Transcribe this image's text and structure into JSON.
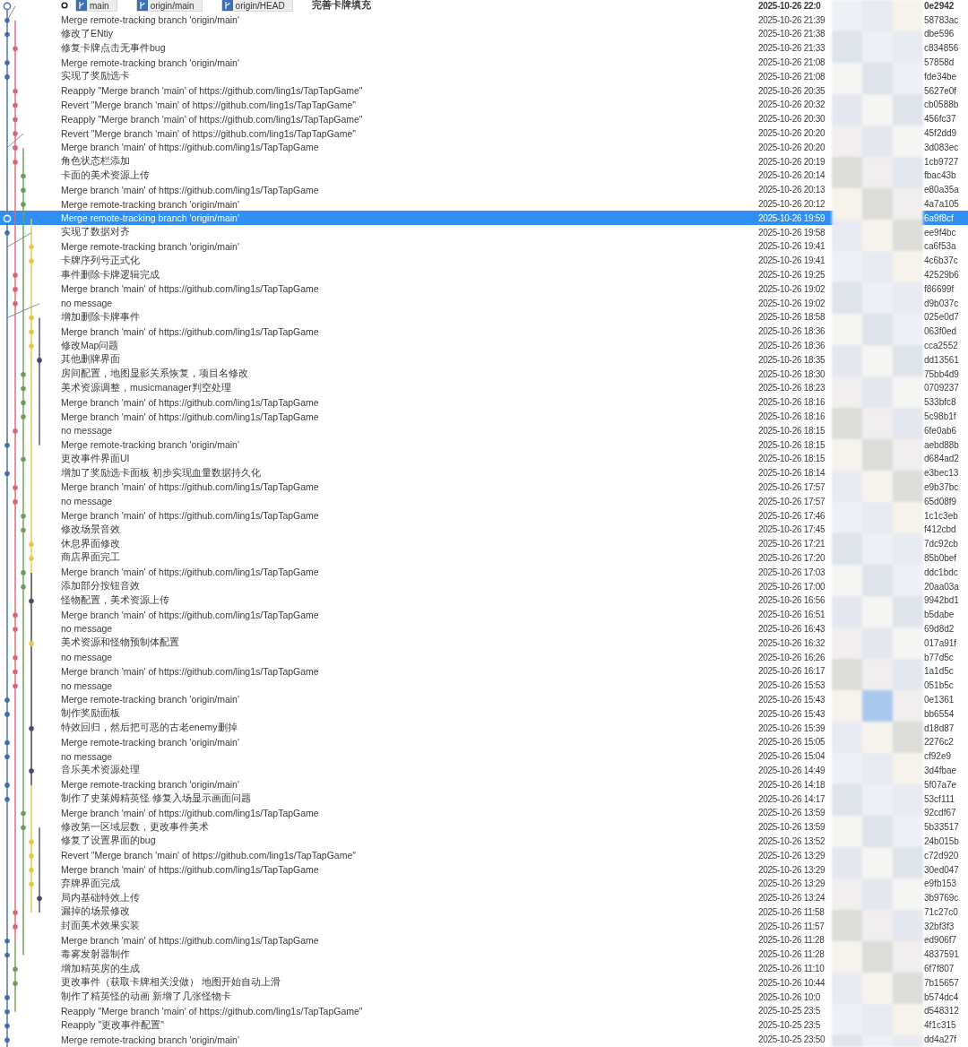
{
  "head": {
    "refs": [
      "main",
      "origin/main",
      "origin/HEAD"
    ],
    "message": "完善卡牌填充",
    "date": "2025-10-26 22:0",
    "hash": "0e2942"
  },
  "commits": [
    {
      "message": "Merge remote-tracking branch 'origin/main'",
      "date": "2025-10-26 21:39",
      "hash": "58783ac",
      "selected": false
    },
    {
      "message": "修改了ENtiy",
      "date": "2025-10-26 21:38",
      "hash": "dbe596",
      "selected": false
    },
    {
      "message": "修复卡牌点击无事件bug",
      "date": "2025-10-26 21:33",
      "hash": "c834856",
      "selected": false
    },
    {
      "message": "Merge remote-tracking branch 'origin/main'",
      "date": "2025-10-26 21:08",
      "hash": "57858d",
      "selected": false
    },
    {
      "message": "实现了奖励选卡",
      "date": "2025-10-26 21:08",
      "hash": "fde34be",
      "selected": false
    },
    {
      "message": "Reapply \"Merge branch 'main' of https://github.com/ling1s/TapTapGame\"",
      "date": "2025-10-26 20:35",
      "hash": "5627e0f",
      "selected": false
    },
    {
      "message": "Revert \"Merge branch 'main' of https://github.com/ling1s/TapTapGame\"",
      "date": "2025-10-26 20:32",
      "hash": "cb0588b",
      "selected": false
    },
    {
      "message": "Reapply \"Merge branch 'main' of https://github.com/ling1s/TapTapGame\"",
      "date": "2025-10-26 20:30",
      "hash": "456fc37",
      "selected": false
    },
    {
      "message": "Revert \"Merge branch 'main' of https://github.com/ling1s/TapTapGame\"",
      "date": "2025-10-26 20:20",
      "hash": "45f2dd9",
      "selected": false
    },
    {
      "message": "Merge branch 'main' of https://github.com/ling1s/TapTapGame",
      "date": "2025-10-26 20:20",
      "hash": "3d083ec",
      "selected": false
    },
    {
      "message": "角色状态栏添加",
      "date": "2025-10-26 20:19",
      "hash": "1cb9727",
      "selected": false
    },
    {
      "message": "卡面的美术资源上传",
      "date": "2025-10-26 20:14",
      "hash": "fbac43b",
      "selected": false
    },
    {
      "message": "Merge branch 'main' of https://github.com/ling1s/TapTapGame",
      "date": "2025-10-26 20:13",
      "hash": "e80a35a",
      "selected": false
    },
    {
      "message": "Merge remote-tracking branch 'origin/main'",
      "date": "2025-10-26 20:12",
      "hash": "4a7a105",
      "selected": false
    },
    {
      "message": "Merge remote-tracking branch 'origin/main'",
      "date": "2025-10-26 19:59",
      "hash": "6a9f8cf",
      "selected": true
    },
    {
      "message": "实现了数据对齐",
      "date": "2025-10-26 19:58",
      "hash": "ee9f4bc",
      "selected": false
    },
    {
      "message": "Merge remote-tracking branch 'origin/main'",
      "date": "2025-10-26 19:41",
      "hash": "ca6f53a",
      "selected": false
    },
    {
      "message": "卡牌序列号正式化",
      "date": "2025-10-26 19:41",
      "hash": "4c6b37c",
      "selected": false
    },
    {
      "message": "事件删除卡牌逻辑完成",
      "date": "2025-10-26 19:25",
      "hash": "42529b6",
      "selected": false
    },
    {
      "message": "Merge branch 'main' of https://github.com/ling1s/TapTapGame",
      "date": "2025-10-26 19:02",
      "hash": "f86699f",
      "selected": false
    },
    {
      "message": "no message",
      "date": "2025-10-26 19:02",
      "hash": "d9b037c",
      "selected": false
    },
    {
      "message": "增加删除卡牌事件",
      "date": "2025-10-26 18:58",
      "hash": "025e0d7",
      "selected": false
    },
    {
      "message": "Merge branch 'main' of https://github.com/ling1s/TapTapGame",
      "date": "2025-10-26 18:36",
      "hash": "063f0ed",
      "selected": false
    },
    {
      "message": "修改Map问题",
      "date": "2025-10-26 18:36",
      "hash": "cca2552",
      "selected": false
    },
    {
      "message": "其他删牌界面",
      "date": "2025-10-26 18:35",
      "hash": "dd13561",
      "selected": false
    },
    {
      "message": "房间配置，地图显影关系恢复，项目名修改",
      "date": "2025-10-26 18:30",
      "hash": "75bb4d9",
      "selected": false
    },
    {
      "message": "美术资源调整，musicmanager判空处理",
      "date": "2025-10-26 18:23",
      "hash": "0709237",
      "selected": false
    },
    {
      "message": "Merge branch 'main' of https://github.com/ling1s/TapTapGame",
      "date": "2025-10-26 18:16",
      "hash": "533bfc8",
      "selected": false
    },
    {
      "message": "Merge branch 'main' of https://github.com/ling1s/TapTapGame",
      "date": "2025-10-26 18:16",
      "hash": "5c98b1f",
      "selected": false
    },
    {
      "message": "no message",
      "date": "2025-10-26 18:15",
      "hash": "6fe0ab6",
      "selected": false
    },
    {
      "message": "Merge remote-tracking branch 'origin/main'",
      "date": "2025-10-26 18:15",
      "hash": "aebd88b",
      "selected": false
    },
    {
      "message": "更改事件界面UI",
      "date": "2025-10-26 18:15",
      "hash": "d684ad2",
      "selected": false
    },
    {
      "message": "增加了奖励选卡面板 初步实现血量数据持久化",
      "date": "2025-10-26 18:14",
      "hash": "e3bec13",
      "selected": false
    },
    {
      "message": "Merge branch 'main' of https://github.com/ling1s/TapTapGame",
      "date": "2025-10-26 17:57",
      "hash": "e9b37bc",
      "selected": false
    },
    {
      "message": "no message",
      "date": "2025-10-26 17:57",
      "hash": "65d08f9",
      "selected": false
    },
    {
      "message": "Merge branch 'main' of https://github.com/ling1s/TapTapGame",
      "date": "2025-10-26 17:46",
      "hash": "1c1c3eb",
      "selected": false
    },
    {
      "message": "修改场景音效",
      "date": "2025-10-26 17:45",
      "hash": "f412cbd",
      "selected": false
    },
    {
      "message": "休息界面修改",
      "date": "2025-10-26 17:21",
      "hash": "7dc92cb",
      "selected": false
    },
    {
      "message": "商店界面完工",
      "date": "2025-10-26 17:20",
      "hash": "85b0bef",
      "selected": false
    },
    {
      "message": "Merge branch 'main' of https://github.com/ling1s/TapTapGame",
      "date": "2025-10-26 17:03",
      "hash": "ddc1bdc",
      "selected": false
    },
    {
      "message": "添加部分按钮音效",
      "date": "2025-10-26 17:00",
      "hash": "20aa03a",
      "selected": false
    },
    {
      "message": "怪物配置，美术资源上传",
      "date": "2025-10-26 16:56",
      "hash": "9942bd1",
      "selected": false
    },
    {
      "message": "Merge branch 'main' of https://github.com/ling1s/TapTapGame",
      "date": "2025-10-26 16:51",
      "hash": "b5dabe",
      "selected": false
    },
    {
      "message": "no message",
      "date": "2025-10-26 16:43",
      "hash": "69d8d2",
      "selected": false
    },
    {
      "message": "美术资源和怪物预制体配置",
      "date": "2025-10-26 16:32",
      "hash": "017a91f",
      "selected": false
    },
    {
      "message": "no message",
      "date": "2025-10-26 16:26",
      "hash": "b77d5c",
      "selected": false
    },
    {
      "message": "Merge branch 'main' of https://github.com/ling1s/TapTapGame",
      "date": "2025-10-26 16:17",
      "hash": "1a1d5c",
      "selected": false
    },
    {
      "message": "no message",
      "date": "2025-10-26 15:53",
      "hash": "051b5c",
      "selected": false
    },
    {
      "message": "Merge remote-tracking branch 'origin/main'",
      "date": "2025-10-26 15:43",
      "hash": "0e1361",
      "selected": false
    },
    {
      "message": "制作奖励面板",
      "date": "2025-10-26 15:43",
      "hash": "bb6554",
      "selected": false
    },
    {
      "message": "特效回归，然后把可恶的古老enemy删掉",
      "date": "2025-10-26 15:39",
      "hash": "d18d87",
      "selected": false
    },
    {
      "message": "Merge remote-tracking branch 'origin/main'",
      "date": "2025-10-26 15:05",
      "hash": "2276c2",
      "selected": false
    },
    {
      "message": "no message",
      "date": "2025-10-26 15:04",
      "hash": "cf92e9",
      "selected": false
    },
    {
      "message": "音乐美术资源处理",
      "date": "2025-10-26 14:49",
      "hash": "3d4fbae",
      "selected": false
    },
    {
      "message": "Merge remote-tracking branch 'origin/main'",
      "date": "2025-10-26 14:18",
      "hash": "5f07a7e",
      "selected": false
    },
    {
      "message": "制作了史莱姆精英怪 修复入场显示画面问题",
      "date": "2025-10-26 14:17",
      "hash": "53cf111",
      "selected": false
    },
    {
      "message": "Merge branch 'main' of https://github.com/ling1s/TapTapGame",
      "date": "2025-10-26 13:59",
      "hash": "92cdf67",
      "selected": false
    },
    {
      "message": "修改第一区域层数，更改事件美术",
      "date": "2025-10-26 13:59",
      "hash": "5b33517",
      "selected": false
    },
    {
      "message": "修复了设置界面的bug",
      "date": "2025-10-26 13:52",
      "hash": "24b015b",
      "selected": false
    },
    {
      "message": "Revert \"Merge branch 'main' of https://github.com/ling1s/TapTapGame\"",
      "date": "2025-10-26 13:29",
      "hash": "c72d920",
      "selected": false
    },
    {
      "message": "Merge branch 'main' of https://github.com/ling1s/TapTapGame",
      "date": "2025-10-26 13:29",
      "hash": "30ed047",
      "selected": false
    },
    {
      "message": "弃牌界面完成",
      "date": "2025-10-26 13:29",
      "hash": "e9fb153",
      "selected": false
    },
    {
      "message": "局内基础特效上传",
      "date": "2025-10-26 13:24",
      "hash": "3b9769c",
      "selected": false
    },
    {
      "message": "漏掉的场景修改",
      "date": "2025-10-26 11:58",
      "hash": "71c27c0",
      "selected": false
    },
    {
      "message": "封面美术效果实装",
      "date": "2025-10-26 11:57",
      "hash": "32bf3f3",
      "selected": false
    },
    {
      "message": "Merge branch 'main' of https://github.com/ling1s/TapTapGame",
      "date": "2025-10-26 11:28",
      "hash": "ed906f7",
      "selected": false
    },
    {
      "message": "毒雾发射器制作",
      "date": "2025-10-26 11:28",
      "hash": "4837591",
      "selected": false
    },
    {
      "message": "增加精英房的生成",
      "date": "2025-10-26 11:10",
      "hash": "6f7f807",
      "selected": false
    },
    {
      "message": "更改事件（获取卡牌相关没做） 地图开始自动上滑",
      "date": "2025-10-26 10:44",
      "hash": "7b15657",
      "selected": false
    },
    {
      "message": "制作了精英怪的动画 新增了几张怪物卡",
      "date": "2025-10-26 10:0",
      "hash": "b574dc4",
      "selected": false
    },
    {
      "message": "Reapply \"Merge branch 'main' of https://github.com/ling1s/TapTapGame\"",
      "date": "2025-10-25 23:5",
      "hash": "d548312",
      "selected": false
    },
    {
      "message": "Reapply \"更改事件配置\"",
      "date": "2025-10-25 23:5",
      "hash": "4f1c315",
      "selected": false
    },
    {
      "message": "Merge remote-tracking branch 'origin/main'",
      "date": "2025-10-25 23:50",
      "hash": "dd4a27f",
      "selected": false
    }
  ]
}
